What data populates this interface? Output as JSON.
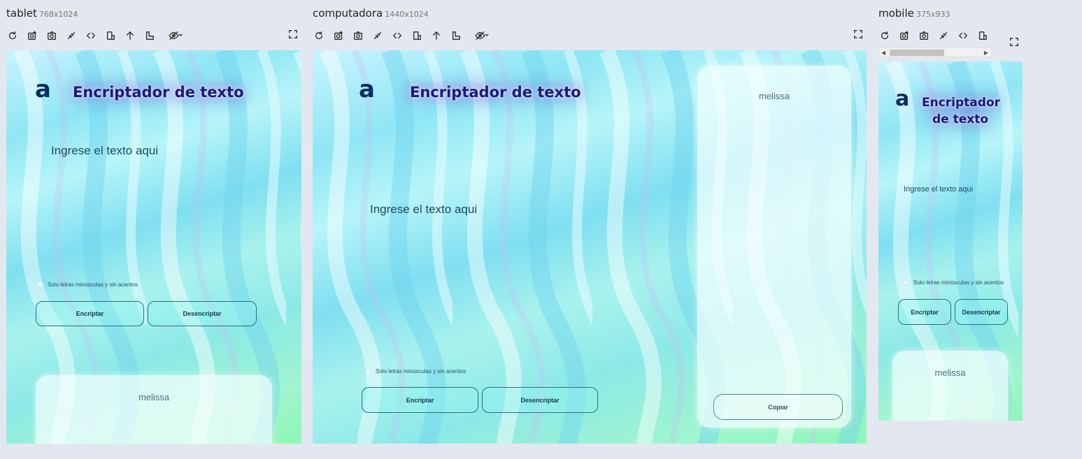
{
  "devices": [
    {
      "name": "tablet",
      "dims": "768x1024"
    },
    {
      "name": "computadora",
      "dims": "1440x1024"
    },
    {
      "name": "mobile",
      "dims": "375x933"
    }
  ],
  "app": {
    "logo": "a",
    "title": "Encriptador de texto",
    "input_placeholder": "Ingrese el texto aqui",
    "hint": "Solo letras minúsculas y sin acentos",
    "encrypt_label": "Encriptar",
    "decrypt_label": "Desencriptar",
    "output_text": "melissa",
    "copy_label": "Copiar"
  },
  "icons": [
    "refresh-icon",
    "screenshot-settings-icon",
    "camera-icon",
    "connect-icon",
    "code-icon",
    "rotate-device-icon",
    "arrow-up-icon",
    "ruler-icon",
    "hide-eye-icon",
    "fullscreen-icon"
  ]
}
